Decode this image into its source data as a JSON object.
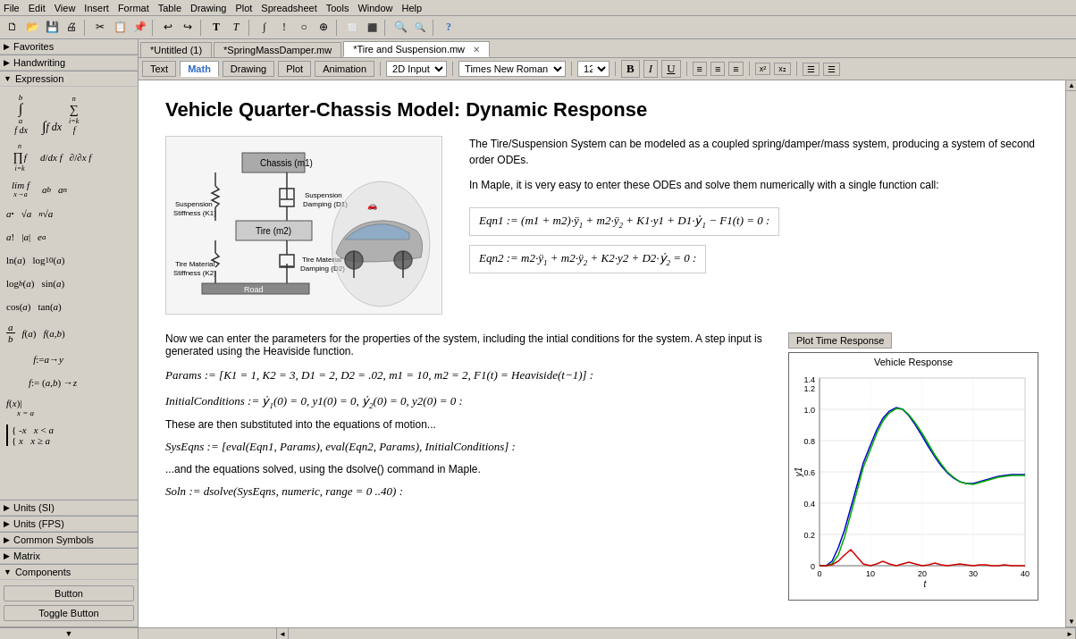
{
  "menubar": {
    "items": [
      "File",
      "Edit",
      "View",
      "Insert",
      "Format",
      "Table",
      "Drawing",
      "Plot",
      "Spreadsheet",
      "Tools",
      "Window",
      "Help"
    ]
  },
  "toolbar": {
    "buttons": [
      "new",
      "open",
      "save",
      "print",
      "cut",
      "copy",
      "paste",
      "undo",
      "redo",
      "bold-T",
      "italic-T",
      "insert-text",
      "align-left",
      "align-center",
      "zoom-in",
      "zoom-out"
    ]
  },
  "doctabs": {
    "tabs": [
      {
        "label": "*Untitled (1)",
        "id": "untitled",
        "active": false
      },
      {
        "label": "*SpringMassDamper.mw",
        "id": "spring",
        "active": false
      },
      {
        "label": "*Tire and Suspension.mw",
        "id": "tire",
        "active": true
      }
    ]
  },
  "formatbar": {
    "tabs": [
      "Text",
      "Math",
      "Drawing",
      "Plot",
      "Animation"
    ],
    "active": "Math",
    "input_mode": "2D Input",
    "font": "Times New Roman",
    "size": "12",
    "buttons": [
      "Bold",
      "Italic",
      "Underline",
      "align-left",
      "align-center",
      "align-right",
      "list1",
      "list2"
    ]
  },
  "document": {
    "title": "Vehicle Quarter-Chassis Model: Dynamic Response",
    "intro_text": "The Tire/Suspension System can be modeled as a coupled spring/damper/mass system, producing a system of second order ODEs.",
    "maple_text": "In Maple, it is very easy to enter these ODEs and solve them numerically with a single function call:",
    "eqn1": "Eqn1 := (m1 + m2)·ÿ1 + m2·ÿ2 + K1·y1 + D1·ẏ1 − F1(t) = 0 :",
    "eqn2": "Eqn2 := m2·ÿ1 + m2·ÿ2 + K2·y2 + D2·ẏ2 = 0 :",
    "params_intro": "Now we can enter the parameters for the properties of the system, including the intial conditions for the system. A step input is generated using the Heaviside function.",
    "params_line": "Params := [ K1 = 1, K2 = 3, D1 = 2, D2 = .02, m1 = 10, m2 = 2, F1(t) = Heaviside(t−1) ] :",
    "ic_line": "InitialConditions := ẏ1(0) = 0, y1(0) = 0, ẏ2(0) = 0, y2(0) = 0 :",
    "subst_text": "These are then substituted into the equations of motion...",
    "syseqns_line": "SysEqns := [ eval(Eqn1, Params), eval(Eqn2, Params), InitialConditions ] :",
    "solve_text": "...and the equations solved, using the dsolve() command in Maple.",
    "soln_line": "Soln := dsolve(SysEqns, numeric, range = 0 ..40) :",
    "plot_btn": "Plot Time Response",
    "chart_title": "Vehicle Response",
    "chart_xlabel": "t",
    "chart_ylabel": "y1"
  },
  "leftpanel": {
    "sections": [
      {
        "label": "Favorites",
        "collapsed": false
      },
      {
        "label": "Handwriting",
        "collapsed": false
      },
      {
        "label": "Expression",
        "collapsed": false,
        "expanded": true
      },
      {
        "label": "Units (SI)",
        "collapsed": true
      },
      {
        "label": "Units (FPS)",
        "collapsed": true
      },
      {
        "label": "Common Symbols",
        "collapsed": true
      },
      {
        "label": "Matrix",
        "collapsed": true
      },
      {
        "label": "Components",
        "collapsed": false
      }
    ],
    "expr_items": [
      "∫ₐᵇ f dx",
      "∫ f dx",
      "∑f",
      "∏f",
      "d/dx f",
      "∂/∂x f",
      "lim f",
      "aᵇ",
      "aₙ",
      "a•",
      "√a",
      "ⁿ√a",
      "a!",
      "|a|",
      "eᵃ",
      "ln(a)",
      "log₁₀(a)",
      "",
      "log_b(a)",
      "sin(a)",
      "",
      "cos(a)",
      "tan(a)",
      "",
      "(a/b)",
      "f(a)",
      "f(a,b)",
      "f := a → y",
      "",
      "",
      "f := (a,b) → z",
      "",
      "",
      "f(x)|x=a",
      "",
      "",
      "{-x x<a",
      "",
      "",
      "{x x≥a",
      "",
      ""
    ],
    "buttons": [
      "Button",
      "Toggle Button"
    ]
  }
}
